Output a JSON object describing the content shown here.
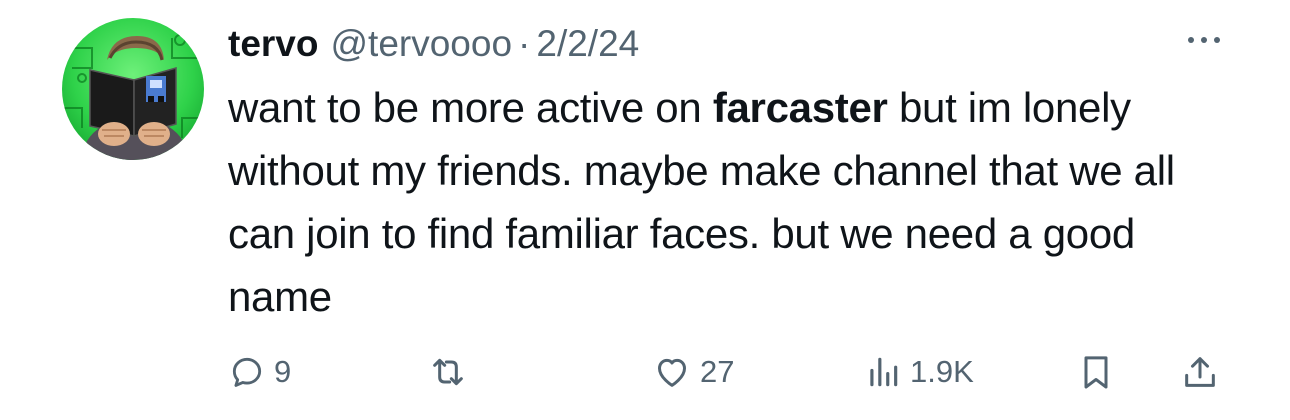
{
  "author": {
    "display_name": "tervo",
    "handle": "@tervoooo",
    "separator": "·",
    "date": "2/2/24"
  },
  "tweet": {
    "text_before": "want to be more active on ",
    "mention": "farcaster",
    "text_after": " but im lonely without my friends. maybe make channel that we all can join to find familiar faces. but we need a good name"
  },
  "actions": {
    "reply_count": "9",
    "retweet_count": "",
    "like_count": "27",
    "view_count": "1.9K"
  },
  "icons": {
    "more": "more-dots-icon",
    "reply": "reply-icon",
    "retweet": "retweet-icon",
    "like": "heart-icon",
    "views": "views-chart-icon",
    "bookmark": "bookmark-icon",
    "share": "share-icon"
  },
  "colors": {
    "text_primary": "#0f1419",
    "text_secondary": "#536471",
    "avatar_green": "#2fd24a"
  }
}
